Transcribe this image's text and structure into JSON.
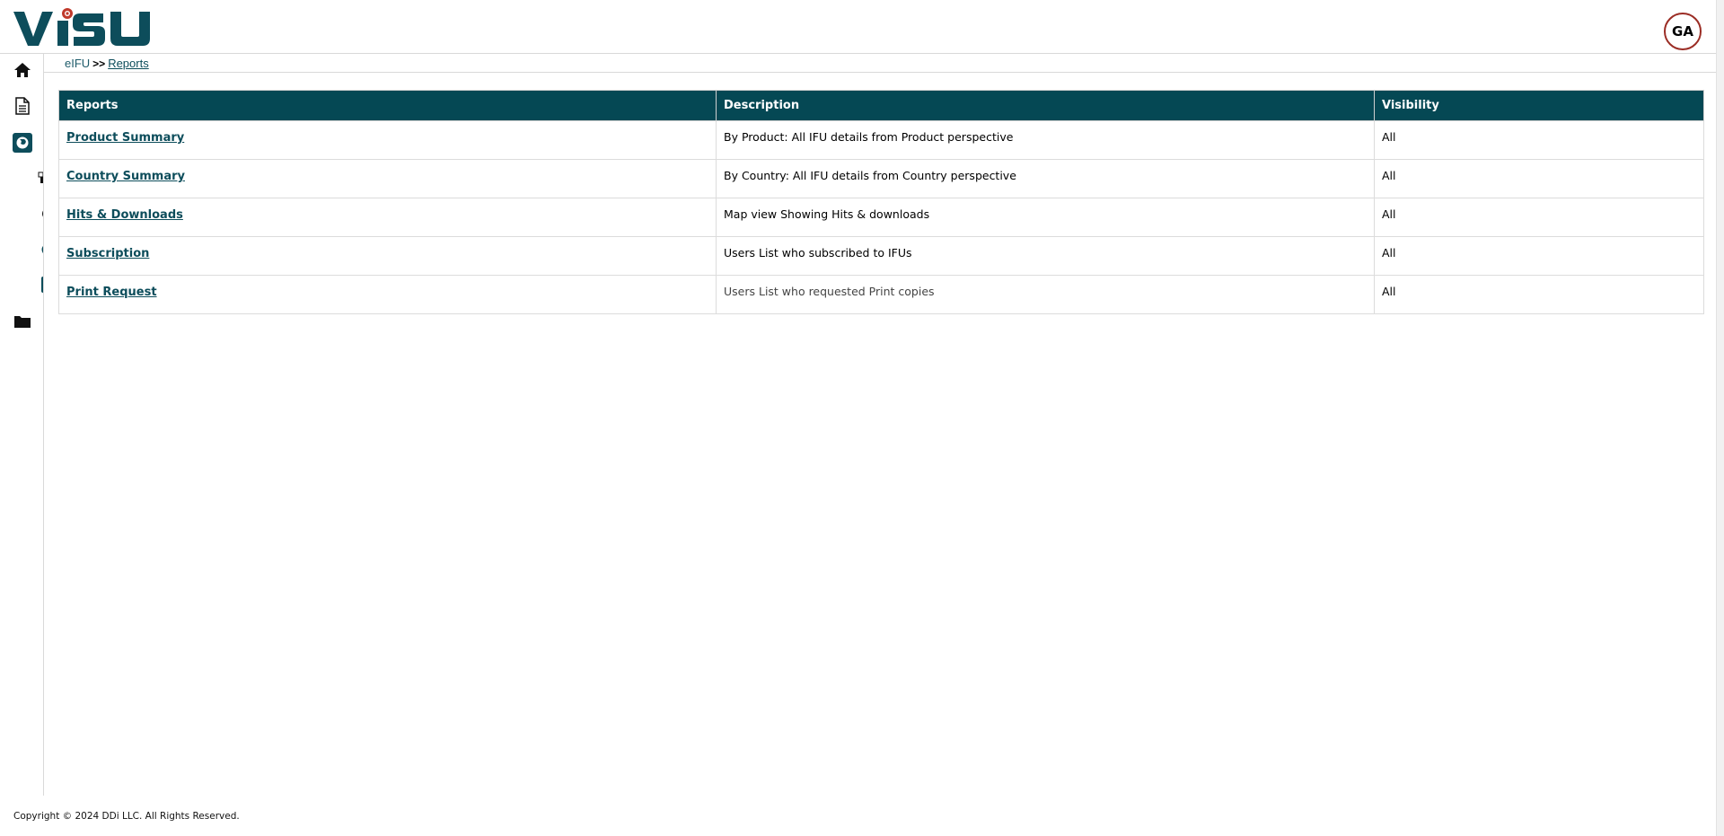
{
  "header": {
    "logo_text": "VISU",
    "avatar_initials": "GA"
  },
  "breadcrumb": {
    "root": "eIFU",
    "separator": ">>",
    "current": "Reports"
  },
  "table": {
    "headers": [
      "Reports",
      "Description",
      "Visibility"
    ],
    "rows": [
      {
        "report": "Product Summary",
        "description": "By Product: All IFU details from Product perspective",
        "visibility": "All"
      },
      {
        "report": "Country Summary",
        "description": "By Country: All IFU details from Country perspective",
        "visibility": "All"
      },
      {
        "report": "Hits & Downloads",
        "description": "Map view Showing Hits & downloads",
        "visibility": "All"
      },
      {
        "report": "Subscription",
        "description": "Users List who subscribed to IFUs",
        "visibility": "All"
      },
      {
        "report": "Print Request",
        "description": "Users List who requested Print copies",
        "visibility": "All"
      }
    ]
  },
  "sidebar": {
    "icons": [
      "home-icon",
      "document-icon",
      "globe-icon",
      "box-icon",
      "circle-icon",
      "refresh-icon",
      "chart-icon",
      "folder-icon"
    ]
  },
  "footer": {
    "copyright": "Copyright © 2024 DDi LLC. All Rights Reserved."
  },
  "colors": {
    "brand": "#0d4d5b",
    "table_header_bg": "#054854",
    "accent_red": "#c0392b",
    "avatar_border": "#9b2d25"
  }
}
